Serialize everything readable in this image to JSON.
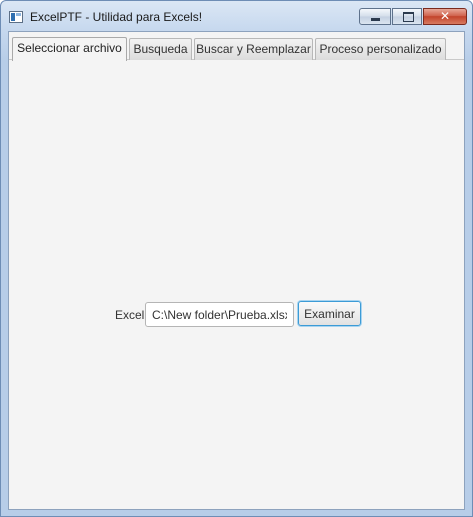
{
  "window": {
    "title": "ExcelPTF - Utilidad para Excels!",
    "close_glyph": "✕"
  },
  "tabs": [
    {
      "label": "Seleccionar archivo",
      "selected": true
    },
    {
      "label": "Busqueda",
      "selected": false
    },
    {
      "label": "Buscar y Reemplazar",
      "selected": false
    },
    {
      "label": "Proceso personalizado",
      "selected": false
    }
  ],
  "file_selector": {
    "label": "Excel",
    "path_value": "C:\\New folder\\Prueba.xlsx",
    "browse_label": "Examinar"
  },
  "colors": {
    "focus_accent": "#3c9bd6",
    "close_button": "#c2432b"
  }
}
